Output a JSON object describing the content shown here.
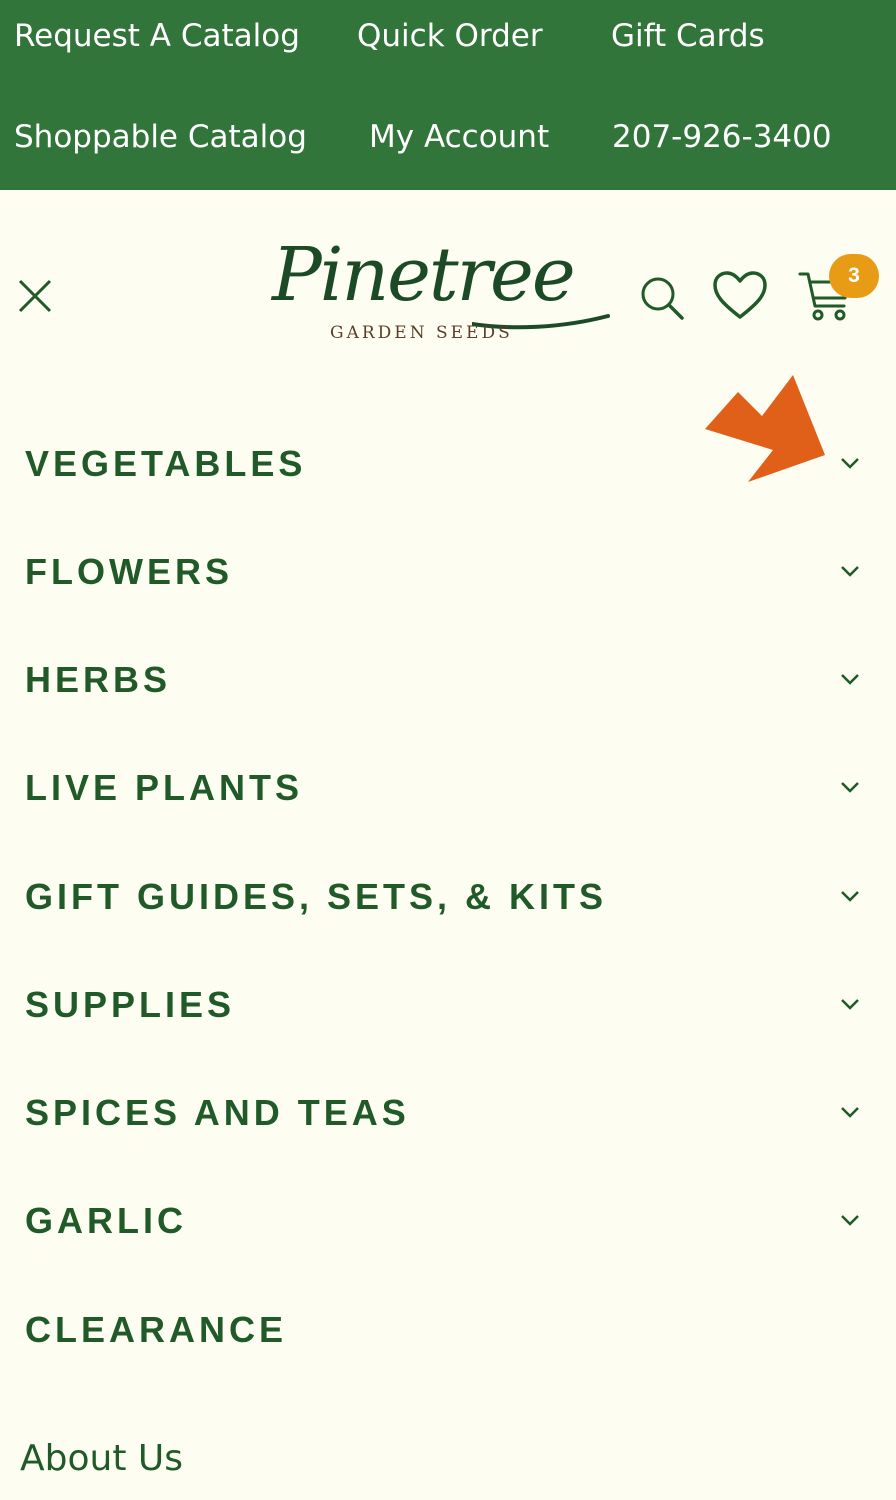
{
  "topbar": {
    "links": [
      {
        "label": "Request A Catalog"
      },
      {
        "label": "Quick Order"
      },
      {
        "label": "Gift Cards"
      },
      {
        "label": "Shoppable Catalog"
      },
      {
        "label": "My Account"
      },
      {
        "label": "207-926-3400"
      }
    ]
  },
  "header": {
    "logo_text": "Pinetree",
    "logo_subtext": "GARDEN SEEDS",
    "cart_count": "3",
    "icons": [
      "close-icon",
      "search-icon",
      "heart-icon",
      "cart-icon"
    ]
  },
  "menu": {
    "items": [
      {
        "label": "VEGETABLES",
        "expandable": true
      },
      {
        "label": "FLOWERS",
        "expandable": true
      },
      {
        "label": "HERBS",
        "expandable": true
      },
      {
        "label": "LIVE PLANTS",
        "expandable": true
      },
      {
        "label": "GIFT GUIDES, SETS, & KITS",
        "expandable": true
      },
      {
        "label": "SUPPLIES",
        "expandable": true
      },
      {
        "label": "SPICES AND TEAS",
        "expandable": true
      },
      {
        "label": "GARLIC",
        "expandable": true
      },
      {
        "label": "CLEARANCE",
        "expandable": false
      }
    ],
    "about_label": "About Us"
  },
  "colors": {
    "topbar_bg": "#32753a",
    "page_bg": "#fdfdf1",
    "text_green": "#1f5a28",
    "badge": "#e89b14",
    "annotation_arrow": "#e0601a"
  }
}
